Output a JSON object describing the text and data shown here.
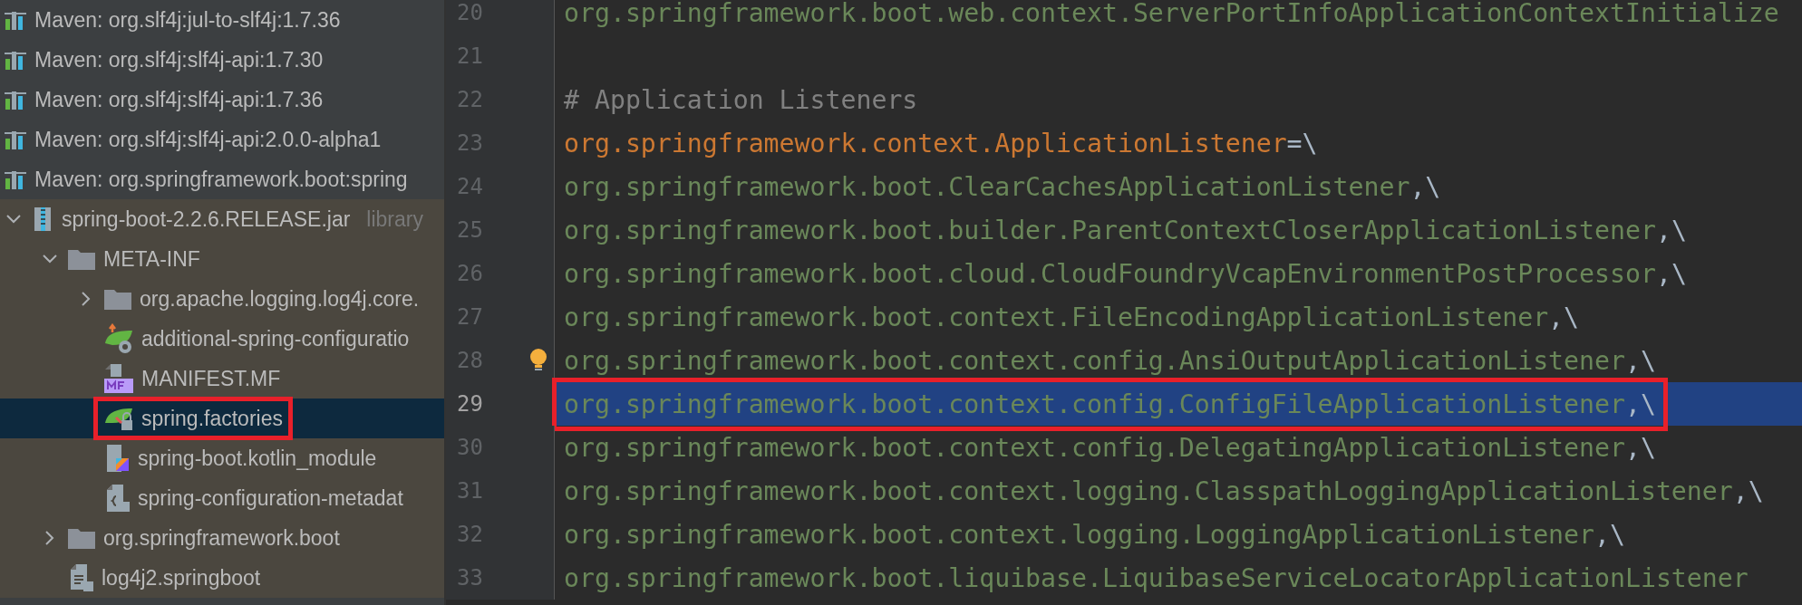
{
  "project_tree": {
    "items": [
      {
        "label": "Maven: org.slf4j:jul-to-slf4j:1.7.36",
        "kind": "library",
        "selected": false,
        "marked": false
      },
      {
        "label": "Maven: org.slf4j:slf4j-api:1.7.30",
        "kind": "library",
        "selected": false,
        "marked": false
      },
      {
        "label": "Maven: org.slf4j:slf4j-api:1.7.36",
        "kind": "library",
        "selected": false,
        "marked": false
      },
      {
        "label": "Maven: org.slf4j:slf4j-api:2.0.0-alpha1",
        "kind": "library",
        "selected": false,
        "marked": false
      },
      {
        "label": "Maven: org.springframework.boot:spring",
        "kind": "library",
        "selected": false,
        "marked": false
      },
      {
        "label": "spring-boot-2.2.6.RELEASE.jar",
        "hint": "library",
        "kind": "jar",
        "expanded": true,
        "selected": false,
        "marked": false,
        "children": [
          {
            "label": "META-INF",
            "kind": "folder",
            "expanded": true,
            "selected": false,
            "marked": false,
            "children": [
              {
                "label": "org.apache.logging.log4j.core.",
                "kind": "folder",
                "expanded": false,
                "selected": false,
                "marked": false
              },
              {
                "label": "additional-spring-configuratio",
                "kind": "config",
                "selected": false,
                "marked": false
              },
              {
                "label": "MANIFEST.MF",
                "kind": "manifest",
                "selected": false,
                "marked": false
              },
              {
                "label": "spring.factories",
                "kind": "factories",
                "selected": true,
                "marked": true
              },
              {
                "label": "spring-boot.kotlin_module",
                "kind": "kotlin",
                "selected": false,
                "marked": false
              },
              {
                "label": "spring-configuration-metadat",
                "kind": "metadata",
                "selected": false,
                "marked": false
              }
            ]
          },
          {
            "label": "org.springframework.boot",
            "kind": "folder",
            "expanded": false,
            "selected": false,
            "marked": false
          },
          {
            "label": "log4j2.springboot",
            "kind": "text",
            "selected": false,
            "marked": false
          }
        ]
      }
    ]
  },
  "editor": {
    "lines": [
      {
        "number": "20",
        "parts": [
          {
            "text": "org.springframework.boot.web.context.ServerPortInfoApplicationContextInitialize",
            "kind": "value"
          }
        ],
        "selected": false,
        "marked": false,
        "bulb": false
      },
      {
        "number": "21",
        "selected": false,
        "marked": false,
        "bulb": false
      },
      {
        "number": "22",
        "parts": [
          {
            "text": "# Application Listeners",
            "kind": "comment"
          }
        ],
        "selected": false,
        "marked": false,
        "bulb": false
      },
      {
        "number": "23",
        "parts": [
          {
            "text": "org.springframework.context.ApplicationListener",
            "kind": "key"
          },
          {
            "text": "=\\",
            "kind": "punct"
          }
        ],
        "selected": false,
        "marked": false,
        "bulb": false
      },
      {
        "number": "24",
        "parts": [
          {
            "text": "org.springframework.boot.ClearCachesApplicationListener",
            "kind": "value"
          },
          {
            "text": ",\\",
            "kind": "punct"
          }
        ],
        "selected": false,
        "marked": false,
        "bulb": false
      },
      {
        "number": "25",
        "parts": [
          {
            "text": "org.springframework.boot.builder.ParentContextCloserApplicationListener",
            "kind": "value"
          },
          {
            "text": ",\\",
            "kind": "punct"
          }
        ],
        "selected": false,
        "marked": false,
        "bulb": false
      },
      {
        "number": "26",
        "parts": [
          {
            "text": "org.springframework.boot.cloud.CloudFoundryVcapEnvironmentPostProcessor",
            "kind": "value"
          },
          {
            "text": ",\\",
            "kind": "punct"
          }
        ],
        "selected": false,
        "marked": false,
        "bulb": false
      },
      {
        "number": "27",
        "parts": [
          {
            "text": "org.springframework.boot.context.FileEncodingApplicationListener",
            "kind": "value"
          },
          {
            "text": ",\\",
            "kind": "punct"
          }
        ],
        "selected": false,
        "marked": false,
        "bulb": false
      },
      {
        "number": "28",
        "parts": [
          {
            "text": "org.springframework.boot.context.config.AnsiOutputApplicationListener",
            "kind": "value"
          },
          {
            "text": ",\\",
            "kind": "punct"
          }
        ],
        "selected": false,
        "marked": false,
        "bulb": true
      },
      {
        "number": "29",
        "parts": [
          {
            "text": "org.springframework.boot.context.config.ConfigFileApplicationListener",
            "kind": "value"
          },
          {
            "text": ",\\",
            "kind": "punct"
          }
        ],
        "selected": true,
        "marked": true,
        "bulb": false
      },
      {
        "number": "30",
        "parts": [
          {
            "text": "org.springframework.boot.context.config.DelegatingApplicationListener",
            "kind": "value"
          },
          {
            "text": ",\\",
            "kind": "punct"
          }
        ],
        "selected": false,
        "marked": false,
        "bulb": false
      },
      {
        "number": "31",
        "parts": [
          {
            "text": "org.springframework.boot.context.logging.ClasspathLoggingApplicationListener",
            "kind": "value"
          },
          {
            "text": ",\\",
            "kind": "punct"
          }
        ],
        "selected": false,
        "marked": false,
        "bulb": false
      },
      {
        "number": "32",
        "parts": [
          {
            "text": "org.springframework.boot.context.logging.LoggingApplicationListener",
            "kind": "value"
          },
          {
            "text": ",\\",
            "kind": "punct"
          }
        ],
        "selected": false,
        "marked": false,
        "bulb": false
      },
      {
        "number": "33",
        "parts": [
          {
            "text": "org.springframework.boot.liquibase.LiquibaseServiceLocatorApplicationListener",
            "kind": "value"
          }
        ],
        "selected": false,
        "marked": false,
        "bulb": false
      }
    ]
  }
}
